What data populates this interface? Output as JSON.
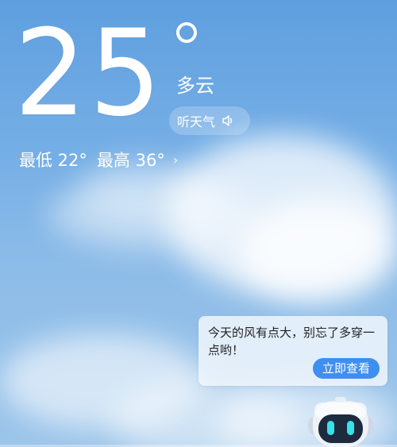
{
  "weather": {
    "temperature": "25",
    "condition": "多云",
    "listen_label": "听天气",
    "low": "最低 22°",
    "high": "最高 36°",
    "chevron": "›"
  },
  "assistant": {
    "message": "今天的风有点大，别忘了多穿一点哟！",
    "action_label": "立即查看",
    "mascot_icon": "robot-mascot-icon"
  },
  "colors": {
    "sky_top": "#5f9fdf",
    "sky_bottom": "#9cc5ea",
    "button_blue": "#3f8ff0",
    "robot_eyes": "#36e3e8"
  },
  "icons": {
    "speaker": "speaker-icon",
    "degree": "degree-icon",
    "chevron": "chevron-right-icon"
  }
}
